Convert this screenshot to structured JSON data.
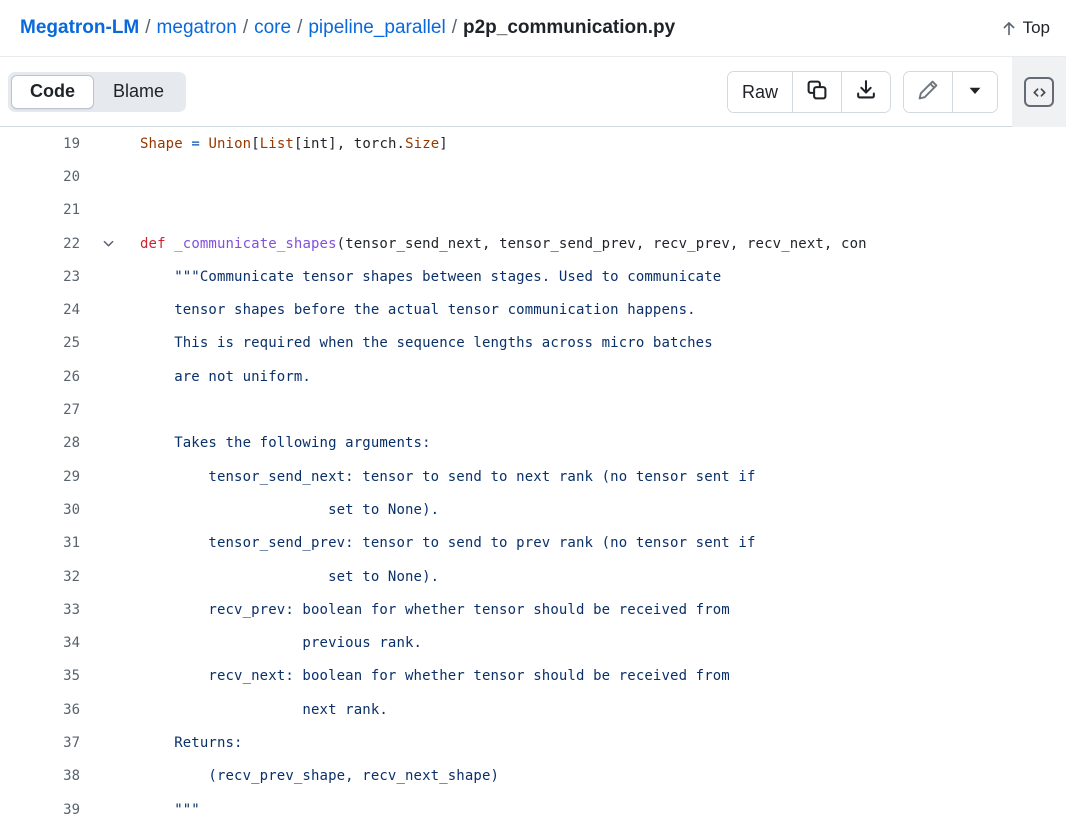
{
  "header": {
    "breadcrumb": {
      "repo": "Megatron-LM",
      "separator": "/",
      "path_parts": [
        "megatron",
        "core",
        "pipeline_parallel"
      ],
      "current_file": "p2p_communication.py"
    },
    "top_link": {
      "label": "Top",
      "icon": "arrow-up-icon"
    }
  },
  "toolbar": {
    "view_switch": {
      "options": [
        "Code",
        "Blame"
      ],
      "selected": "Code"
    },
    "raw_group": {
      "raw_label": "Raw",
      "copy_icon": "copy-icon",
      "download_icon": "download-icon"
    },
    "edit_group": {
      "edit_icon": "pencil-icon",
      "dropdown_icon": "triangle-down-icon"
    },
    "code_view": {
      "icon": "code-brackets-icon"
    }
  },
  "code": {
    "language": "python",
    "lines": [
      {
        "number": "19",
        "foldable": false,
        "tokens": [
          {
            "text": "Shape",
            "cls": "t-var"
          },
          {
            "text": " ",
            "cls": "t-pln"
          },
          {
            "text": "=",
            "cls": "t-op"
          },
          {
            "text": " ",
            "cls": "t-pln"
          },
          {
            "text": "Union",
            "cls": "t-type"
          },
          {
            "text": "[",
            "cls": "t-pln"
          },
          {
            "text": "List",
            "cls": "t-type"
          },
          {
            "text": "[int], torch.",
            "cls": "t-pln"
          },
          {
            "text": "Size",
            "cls": "t-type"
          },
          {
            "text": "]",
            "cls": "t-pln"
          }
        ]
      },
      {
        "number": "20",
        "foldable": false,
        "tokens": []
      },
      {
        "number": "21",
        "foldable": false,
        "tokens": []
      },
      {
        "number": "22",
        "foldable": true,
        "tokens": [
          {
            "text": "def",
            "cls": "t-kw"
          },
          {
            "text": " ",
            "cls": "t-pln"
          },
          {
            "text": "_communicate_shapes",
            "cls": "t-fn"
          },
          {
            "text": "(tensor_send_next, tensor_send_prev, recv_prev, recv_next, con",
            "cls": "t-pln"
          }
        ]
      },
      {
        "number": "23",
        "foldable": false,
        "tokens": [
          {
            "text": "    \"\"\"Communicate tensor shapes between stages. Used to communicate",
            "cls": "t-str"
          }
        ]
      },
      {
        "number": "24",
        "foldable": false,
        "tokens": [
          {
            "text": "    tensor shapes before the actual tensor communication happens.",
            "cls": "t-str"
          }
        ]
      },
      {
        "number": "25",
        "foldable": false,
        "tokens": [
          {
            "text": "    This is required when the sequence lengths across micro batches",
            "cls": "t-str"
          }
        ]
      },
      {
        "number": "26",
        "foldable": false,
        "tokens": [
          {
            "text": "    are not uniform.",
            "cls": "t-str"
          }
        ]
      },
      {
        "number": "27",
        "foldable": false,
        "tokens": []
      },
      {
        "number": "28",
        "foldable": false,
        "tokens": [
          {
            "text": "    Takes the following arguments:",
            "cls": "t-str"
          }
        ]
      },
      {
        "number": "29",
        "foldable": false,
        "tokens": [
          {
            "text": "        tensor_send_next: tensor to send to next rank (no tensor sent if",
            "cls": "t-str"
          }
        ]
      },
      {
        "number": "30",
        "foldable": false,
        "tokens": [
          {
            "text": "                      set to None).",
            "cls": "t-str"
          }
        ]
      },
      {
        "number": "31",
        "foldable": false,
        "tokens": [
          {
            "text": "        tensor_send_prev: tensor to send to prev rank (no tensor sent if",
            "cls": "t-str"
          }
        ]
      },
      {
        "number": "32",
        "foldable": false,
        "tokens": [
          {
            "text": "                      set to None).",
            "cls": "t-str"
          }
        ]
      },
      {
        "number": "33",
        "foldable": false,
        "tokens": [
          {
            "text": "        recv_prev: boolean for whether tensor should be received from",
            "cls": "t-str"
          }
        ]
      },
      {
        "number": "34",
        "foldable": false,
        "tokens": [
          {
            "text": "                   previous rank.",
            "cls": "t-str"
          }
        ]
      },
      {
        "number": "35",
        "foldable": false,
        "tokens": [
          {
            "text": "        recv_next: boolean for whether tensor should be received from",
            "cls": "t-str"
          }
        ]
      },
      {
        "number": "36",
        "foldable": false,
        "tokens": [
          {
            "text": "                   next rank.",
            "cls": "t-str"
          }
        ]
      },
      {
        "number": "37",
        "foldable": false,
        "tokens": [
          {
            "text": "    Returns:",
            "cls": "t-str"
          }
        ]
      },
      {
        "number": "38",
        "foldable": false,
        "tokens": [
          {
            "text": "        (recv_prev_shape, recv_next_shape)",
            "cls": "t-str"
          }
        ]
      },
      {
        "number": "39",
        "foldable": false,
        "tokens": [
          {
            "text": "    \"\"\"",
            "cls": "t-str"
          }
        ]
      }
    ]
  },
  "colors": {
    "link": "#0969da",
    "text": "#1f2328",
    "muted": "#59636e",
    "border": "#d1d9e0",
    "keyword": "#cf222e",
    "function": "#8250df",
    "variable": "#953800",
    "operator": "#0550ae",
    "string": "#0a3069",
    "toolbar_bg": "#eff1f3"
  }
}
